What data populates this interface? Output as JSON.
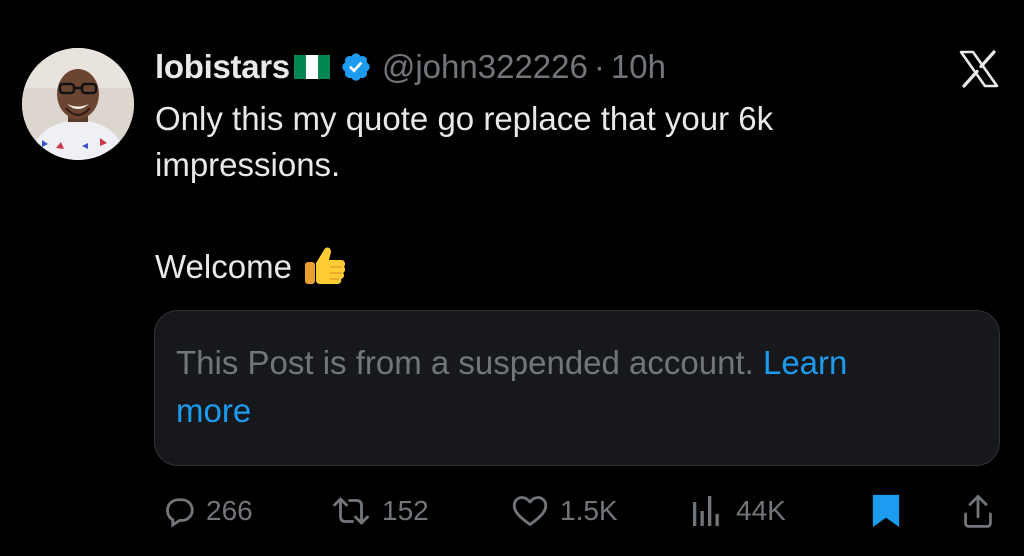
{
  "tweet": {
    "display_name": "lobistars",
    "flag_icon": "nigeria-flag-icon",
    "verified_icon": "verified-badge-icon",
    "handle": "@john322226",
    "separator": "·",
    "time": "10h",
    "text_line_1": "Only this my quote go replace that your 6k",
    "text_line_2": "impressions.",
    "text_line_3": "Welcome",
    "emoji_icon": "thumbs-up-icon"
  },
  "quote": {
    "line_1": "This Post is from a suspended account.",
    "learn_1": "Learn",
    "learn_2": "more"
  },
  "actions": {
    "replies": "266",
    "reposts": "152",
    "likes": "1.5K",
    "views": "44K",
    "bookmark_icon": "bookmark-icon",
    "share_icon": "share-icon"
  },
  "colors": {
    "background": "#000000",
    "text_primary": "#e7e9ea",
    "text_secondary": "#71767b",
    "accent": "#1d9bf0",
    "card_bg": "#16181c",
    "card_border": "#2f3336"
  },
  "platform_icon": "x-logo-icon"
}
